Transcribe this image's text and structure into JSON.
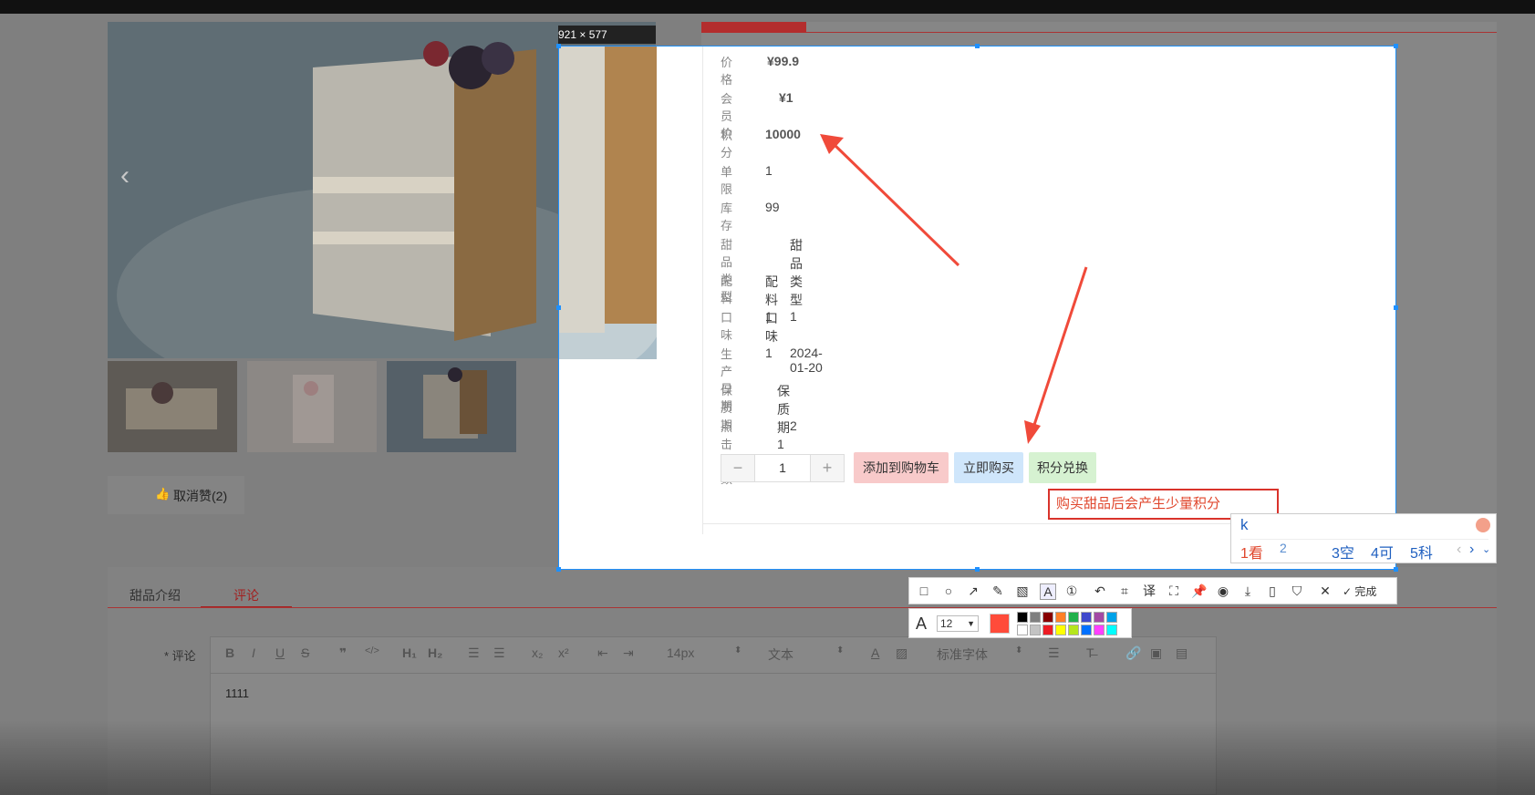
{
  "screenshot": {
    "size_label": "921 × 577",
    "tabs": [
      "甜品介绍",
      "评论"
    ],
    "active_tab": "评论"
  },
  "product": {
    "rows": [
      {
        "label": "价格",
        "value": "¥99.9"
      },
      {
        "label": "会员价",
        "value": "¥1"
      },
      {
        "label": "积分",
        "value": "10000"
      },
      {
        "label": "单限",
        "value": "1"
      },
      {
        "label": "库存",
        "value": "99"
      },
      {
        "label": "甜品类型",
        "value": "甜品类型1"
      },
      {
        "label": "配料",
        "value": "配料1"
      },
      {
        "label": "口味",
        "value": "口味1"
      },
      {
        "label": "生产日期",
        "value": "2024-01-20"
      },
      {
        "label": "保质期",
        "value": "保质期1"
      },
      {
        "label": "点击次数",
        "value": "2"
      }
    ],
    "quantity": "1",
    "minus": "−",
    "plus": "+",
    "add_cart": "添加到购物车",
    "buy_now": "立即购买",
    "points_exchange": "积分兑换",
    "cancel_like": "取消赞(2)"
  },
  "annotation": {
    "text": "购买甜品后会产生少量积分"
  },
  "ime": {
    "input": "k",
    "candidates": [
      "1看",
      "2",
      "3空",
      "4可",
      "5科"
    ]
  },
  "toolbar": {
    "done": "完成",
    "font_size": "12",
    "colors": [
      "#000000",
      "#7f7f7f",
      "#880000",
      "#ff7f27",
      "#22b14c",
      "#3f48cc",
      "#a349a4",
      "#00a2e8",
      "#ffffff",
      "#c3c3c3",
      "#ed1c24",
      "#ffff00",
      "#b5e61d",
      "#0070ff",
      "#ff40ff",
      "#00ffff"
    ],
    "current_color": "#ff4b3a"
  },
  "editor": {
    "label": "* 评论",
    "font_size": "14px",
    "block_type": "文本",
    "font_family": "标准字体",
    "content": "1111"
  }
}
